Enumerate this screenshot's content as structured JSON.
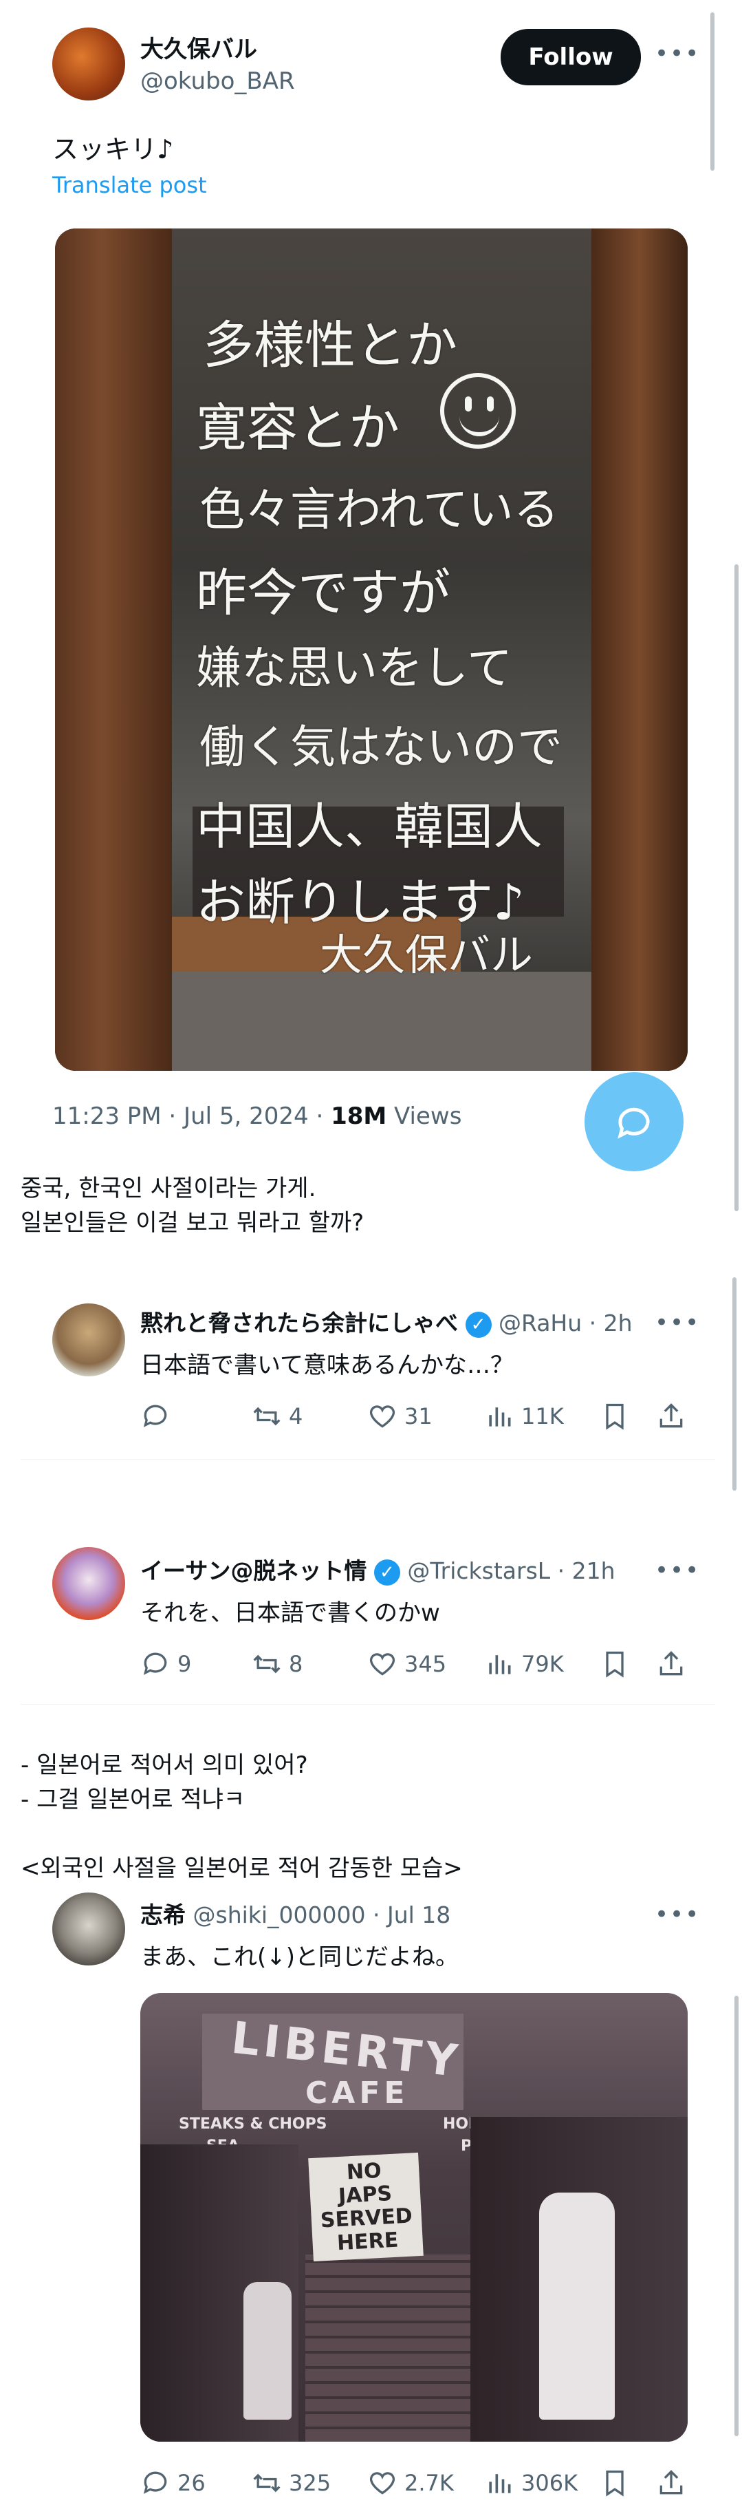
{
  "main_post": {
    "display_name": "大久保バル",
    "handle": "@okubo_BAR",
    "follow_label": "Follow",
    "text": "スッキリ♪",
    "translate_label": "Translate post",
    "handwriting_lines": [
      "多様性とか",
      "寛容とか",
      "色々言われている",
      "昨今ですが",
      "嫌な思いをして",
      "働く気はないので",
      "中国人、韓国人",
      "お断りします♪",
      "大久保バル"
    ],
    "timestamp": "11:23 PM · Jul 5, 2024 · ",
    "views_count": "18M",
    "views_label": " Views"
  },
  "korean_caption_1": [
    "중국, 한국인 사절이라는 가게.",
    "일본인들은 이걸 보고 뭐라고 할까?"
  ],
  "replies": [
    {
      "display_name": "黙れと脅されたら余計にしゃべ",
      "handle_time": "@RaHu · 2h",
      "text": "日本語で書いて意味あるんかな…？",
      "replies": "",
      "reposts": "4",
      "likes": "31",
      "views": "11K"
    },
    {
      "display_name": "イーサン@脱ネット情",
      "handle_time": "@TrickstarsL · 21h",
      "text": "それを、日本語で書くのかw",
      "replies": "9",
      "reposts": "8",
      "likes": "345",
      "views": "79K"
    }
  ],
  "korean_caption_2": [
    "- 일본어로 적어서 의미 있어?",
    "- 그걸 일본어로 적냐ㅋ",
    "",
    "<외국인 사절을 일본어로 적어 감동한 모습>"
  ],
  "reply3": {
    "display_name": "志希",
    "handle_time": "@shiki_000000 · Jul 18",
    "text": "まあ、これ(↓)と同じだよね。",
    "sign_liberty": "LIBERTY",
    "sign_cafe": "CAFE",
    "sign_steaks": "STEAKS & CHOPS",
    "sign_sea": "SEA",
    "sign_home": "HOME",
    "sign_pa": "PA",
    "sign_no": "NO",
    "sign_japs": "JAPS",
    "sign_served": "SERVED",
    "sign_here": "HERE",
    "replies": "26",
    "reposts": "325",
    "likes": "2.7K",
    "views": "306K"
  },
  "colors": {
    "accent": "#1d9bf0",
    "text": "#0f1419",
    "muted": "#536471",
    "separator": "#eff3f4",
    "fab": "#6cc5f7"
  }
}
